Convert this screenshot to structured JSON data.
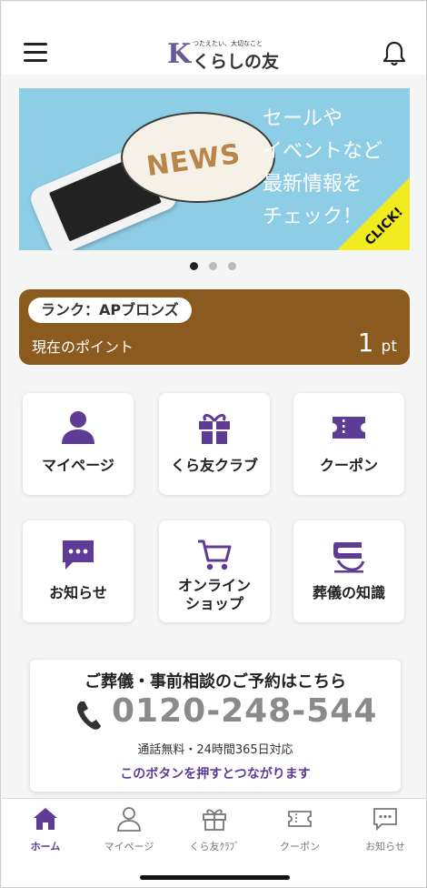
{
  "header": {
    "logo_tagline": "つたえたい、大切なこと",
    "logo_text": "くらしの友",
    "logo_mark": "K"
  },
  "banner": {
    "news_label": "NEWS",
    "lines": [
      "セールや",
      "イベントなど",
      "最新情報を",
      "チェック！"
    ],
    "click_label": "CLICK!",
    "slide_count": 3,
    "active_slide": 1
  },
  "rank": {
    "label": "ランク：APブロンズ",
    "points_label": "現在のポイント",
    "points_value": "1",
    "points_unit": "pt"
  },
  "menu": {
    "items": [
      {
        "label": "マイページ",
        "icon": "person-icon"
      },
      {
        "label": "くら友クラブ",
        "icon": "gift-icon"
      },
      {
        "label": "クーポン",
        "icon": "ticket-icon"
      },
      {
        "label": "お知らせ",
        "icon": "chat-bubble-icon"
      },
      {
        "label_line1": "オンライン",
        "label_line2": "ショップ",
        "icon": "cart-icon"
      },
      {
        "label": "葬儀の知識",
        "icon": "book-icon"
      }
    ]
  },
  "consult": {
    "title": "ご葬儀・事前相談のご予約はこちら",
    "phone": "0120-248-544",
    "subtitle": "通話無料・24時間365日対応",
    "link": "このボタンを押すとつながります"
  },
  "tabbar": {
    "items": [
      {
        "label": "ホーム",
        "icon": "home-icon",
        "active": true
      },
      {
        "label": "マイページ",
        "icon": "person-outline-icon",
        "active": false
      },
      {
        "label": "くら友ｸﾗﾌﾞ",
        "icon": "gift-outline-icon",
        "active": false
      },
      {
        "label": "クーポン",
        "icon": "ticket-outline-icon",
        "active": false
      },
      {
        "label": "お知らせ",
        "icon": "chat-outline-icon",
        "active": false
      }
    ]
  },
  "colors": {
    "brand_purple": "#5e3c96",
    "rank_brown": "#8b5a1f",
    "banner_blue": "#8ecde6",
    "click_yellow": "#f1ec20",
    "phone_gray": "#8a8a8a"
  }
}
